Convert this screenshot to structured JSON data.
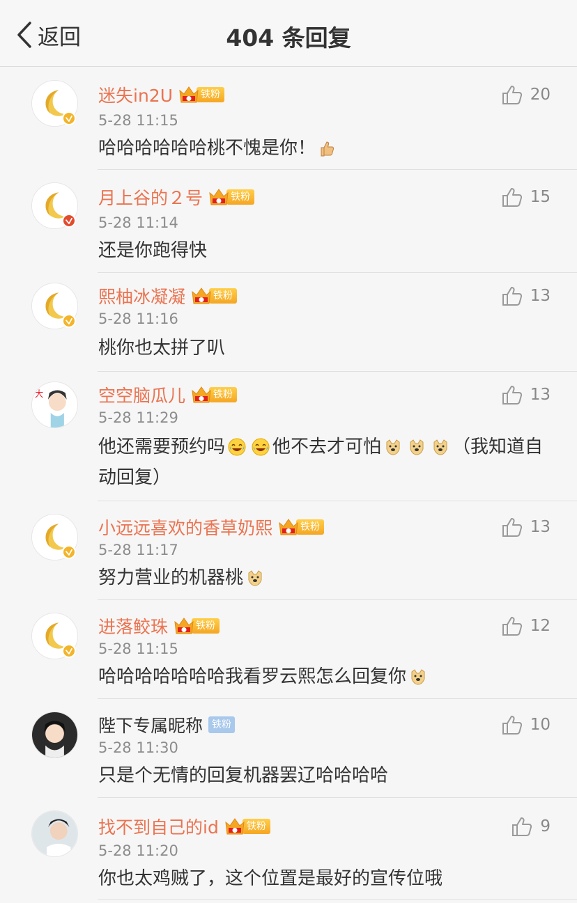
{
  "header": {
    "back_label": "返回",
    "title": "404 条回复"
  },
  "colors": {
    "name_orange": "#eb7350",
    "fan_gold": "#f5a623",
    "fan_blue": "#a8c8ec",
    "verify_gold": "#f3b42a",
    "verify_red": "#e24b2d"
  },
  "comments": [
    {
      "name": "迷失in2U",
      "fan_level": "4",
      "fan_label": "铁粉",
      "time": "5-28 11:15",
      "text": "哈哈哈哈哈哈桃不愧是你！",
      "likes": "20",
      "emoji": [
        "thumbs-up"
      ]
    },
    {
      "name": "月上谷的２号",
      "fan_level": "4",
      "fan_label": "铁粉",
      "time": "5-28 11:14",
      "text": "还是你跑得快",
      "likes": "15"
    },
    {
      "name": "熙柚冰凝凝",
      "fan_level": "3",
      "fan_label": "铁粉",
      "time": "5-28 11:16",
      "text": "桃你也太拼了叭",
      "likes": "13"
    },
    {
      "name": "空空脑瓜儿",
      "fan_level": "5",
      "fan_label": "铁粉",
      "time": "5-28 11:29",
      "text_a": "他还需要预约吗",
      "text_b": "他不去才可怕",
      "text_c": "（我知道自动回复）",
      "likes": "13"
    },
    {
      "name": "小远远喜欢的香草奶熙",
      "fan_level": "4",
      "fan_label": "铁粉",
      "time": "5-28 11:17",
      "text": "努力营业的机器桃",
      "likes": "13"
    },
    {
      "name": "进落鲛珠",
      "fan_level": "5",
      "fan_label": "铁粉",
      "time": "5-28 11:15",
      "text": "哈哈哈哈哈哈哈我看罗云熙怎么回复你",
      "likes": "12"
    },
    {
      "name": "陛下专属昵称",
      "fan_label": "铁粉",
      "time": "5-28 11:30",
      "text": "只是个无情的回复机器罢辽哈哈哈哈",
      "likes": "10"
    },
    {
      "name": "找不到自己的id",
      "fan_level": "2",
      "fan_label": "铁粉",
      "time": "5-28 11:20",
      "text": "你也太鸡贼了，这个位置是最好的宣传位哦",
      "likes": "9"
    }
  ]
}
